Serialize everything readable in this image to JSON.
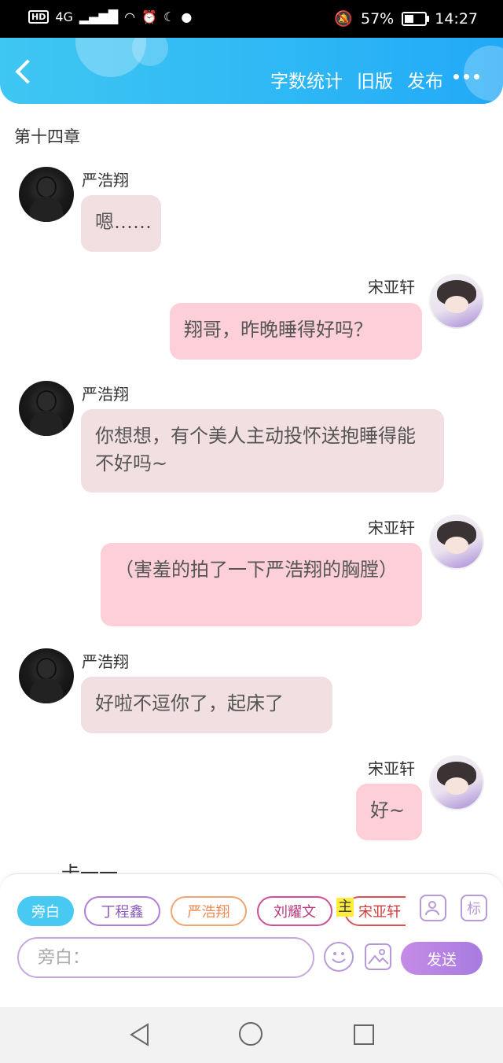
{
  "status_bar": {
    "network": "4G",
    "battery": "57%",
    "battery_level": 0.57,
    "time": "14:27"
  },
  "header": {
    "actions": [
      "字数统计",
      "旧版",
      "发布"
    ]
  },
  "chapter_title": "第十四章",
  "messages": [
    {
      "side": "left",
      "sender": "严浩翔",
      "text": "嗯……"
    },
    {
      "side": "right",
      "sender": "宋亚轩",
      "text": "翔哥，昨晚睡得好吗？"
    },
    {
      "side": "left",
      "sender": "严浩翔",
      "text": "你想想，有个美人主动投怀送抱睡得能不好吗~"
    },
    {
      "side": "right",
      "sender": "宋亚轩",
      "text": "（害羞的拍了一下严浩翔的胸膛）"
    },
    {
      "side": "left",
      "sender": "严浩翔",
      "text": "好啦不逗你了，起床了"
    },
    {
      "side": "right",
      "sender": "宋亚轩",
      "text": "好~"
    }
  ],
  "partial_text": "卡一一",
  "composer": {
    "roles": [
      "旁白",
      "丁程鑫",
      "严浩翔",
      "刘耀文",
      "宋亚轩"
    ],
    "main_badge": "主",
    "tag_icon_label": "标",
    "input_placeholder": "旁白：",
    "send_label": "发送"
  }
}
